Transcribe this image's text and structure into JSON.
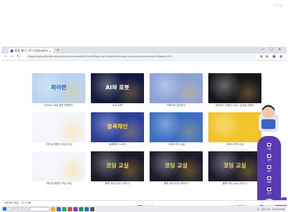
{
  "page": {
    "top_right_dots": "···"
  },
  "browser": {
    "tab_title": "발열 필터 | AI 디지털교과서",
    "tab_close": "×",
    "new_tab": "+",
    "window_controls": {
      "minimize": "—",
      "maximize": "□",
      "close": "×"
    },
    "nav": {
      "back": "←",
      "forward": "→",
      "reload": "↻"
    },
    "url": "https://www.edunet.net/nedu/contsvc/viewWkstContsPopup.do?contentsGrpSeq=xxxxxxxx&menuSeq=0&bbsId=001",
    "downloads_text": "다운로드 파일 - 12.3 MB"
  },
  "cards": [
    {
      "caption": "Python 바로 알면 만만하다",
      "thumb_text": "파이썬",
      "bg": "#b9d4f0",
      "fg": "#2b5db8"
    },
    {
      "caption": "AI와 로봇",
      "thumb_text": "AI와 로봇",
      "bg": "#121a3c",
      "fg": "#ffffff"
    },
    {
      "caption": "빅데이터 분석하기",
      "thumb_text": "",
      "bg": "#8ba2d6",
      "fg": "#ffffff"
    },
    {
      "caption": "메타버스 만들기 교실 - 실감형 콘텐츠",
      "thumb_text": "",
      "bg": "#15151b",
      "fg": "#e0e0e0"
    },
    {
      "caption": "이런 걸 배운다 코딩 교실",
      "thumb_text": "",
      "bg": "#f3f6fb",
      "fg": "#333333"
    },
    {
      "caption": "블록체인 스토리",
      "thumb_text": "블록체인",
      "bg": "#2e3f9a",
      "fg": "#ffd447"
    },
    {
      "caption": "사이버 보안 교실",
      "thumb_text": "",
      "bg": "#3b6fc4",
      "fg": "#ffffff"
    },
    {
      "caption": "데이터 과학 교실",
      "thumb_text": "",
      "bg": "#f2c427",
      "fg": "#1a3d8f"
    },
    {
      "caption": "이런 걸 배운다 코딩 교실",
      "thumb_text": "",
      "bg": "#f3f6fb",
      "fg": "#333333"
    },
    {
      "caption": "블록 코딩 교실 (수학 2)",
      "thumb_text": "코딩 교실",
      "bg": "#1b1b2c",
      "fg": "#f2d94e"
    },
    {
      "caption": "블록 코딩 교실 (과학 2)",
      "thumb_text": "코딩 교실",
      "bg": "#1b1b2c",
      "fg": "#f2d94e"
    },
    {
      "caption": "블록 코딩 교실 (영어 2)",
      "thumb_text": "코딩 교실",
      "bg": "#1b1b2c",
      "fg": "#f2d94e"
    }
  ],
  "pagination": {
    "pages": [
      "1",
      "2",
      "3"
    ],
    "active": "1"
  },
  "select": {
    "value": "12개씩 보기"
  },
  "side_menu": {
    "items": [
      "모음",
      "검색",
      "공유",
      "목록",
      "닫기"
    ]
  },
  "taskbar": {
    "search_placeholder": "검색하려면 여기에 입력",
    "tray_time": "오후 1:23",
    "tray_date": "2023-03-08",
    "tray_lang": "한"
  },
  "colors": {
    "accent": "#5b3bb3",
    "active_page": "#6a4cb8"
  }
}
